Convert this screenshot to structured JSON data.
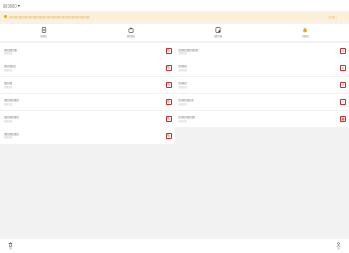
{
  "blurred": true,
  "header": {
    "title": "▯▯▯▯▯▯",
    "caret": "▾"
  },
  "notice": {
    "text": "▯▯▯▯▯▯▯▯▯▯▯▯▯▯▯▯▯▯▯▯▯▯▯▯▯▯▯▯▯▯▯▯▯▯▯▯▯▯▯▯▯▯▯▯▯▯▯▯▯",
    "link": "▯▯▯▯ ›",
    "color": "#f0a020"
  },
  "tabs": [
    {
      "label": "▯▯▯▯",
      "icon": "document-icon"
    },
    {
      "label": "▯▯▯▯▯",
      "icon": "bag-icon"
    },
    {
      "label": "▯▯▯▯▯",
      "icon": "form-icon"
    },
    {
      "label": "▯▯▯▯",
      "icon": "medal-icon"
    }
  ],
  "rows": [
    {
      "left": {
        "title": "▯▯▯▯▯▯▯▯",
        "sub": "▯▯▯▯▯▯",
        "icon": "edit-icon"
      },
      "right": {
        "title": "▯▯▯▯▯▯▯▯▯▯▯▯",
        "sub": "▯▯▯▯▯▯",
        "icon": "close-icon"
      }
    },
    {
      "left": {
        "title": "▯▯▯▯▯▯▯",
        "sub": "▯▯▯▯▯▯",
        "icon": "edit-icon"
      },
      "right": {
        "title": "▯▯▯▯▯",
        "sub": "▯▯▯▯▯▯",
        "icon": "close-icon"
      }
    },
    {
      "left": {
        "title": "▯▯▯▯▯",
        "sub": "▯▯▯▯▯▯",
        "icon": "edit-icon"
      },
      "right": {
        "title": "▯▯▯▯▯",
        "sub": "▯▯▯▯▯▯",
        "icon": "close-icon"
      }
    },
    {
      "left": {
        "title": "▯▯▯▯▯▯▯▯▯",
        "sub": "▯▯▯▯▯▯",
        "icon": "edit-icon"
      },
      "right": {
        "title": "▯▯▯▯▯▯▯▯▯",
        "sub": "▯▯▯▯▯▯",
        "icon": "minus-icon"
      }
    },
    {
      "left": {
        "title": "▯▯▯▯▯▯▯▯▯",
        "sub": "▯▯▯▯▯▯",
        "icon": "edit-icon"
      },
      "right": {
        "title": "▯▯▯▯▯▯▯▯▯▯",
        "sub": "▯▯▯▯▯▯",
        "icon": "grid-icon"
      }
    },
    {
      "left": {
        "title": "▯▯▯▯▯▯▯▯▯",
        "sub": "▯▯▯▯▯▯",
        "icon": "edit-icon"
      },
      "right": null
    }
  ],
  "bottom": {
    "left": {
      "label": "▯▯",
      "icon": "trash-icon"
    },
    "right": {
      "label": "▯▯",
      "icon": "person-icon"
    }
  }
}
